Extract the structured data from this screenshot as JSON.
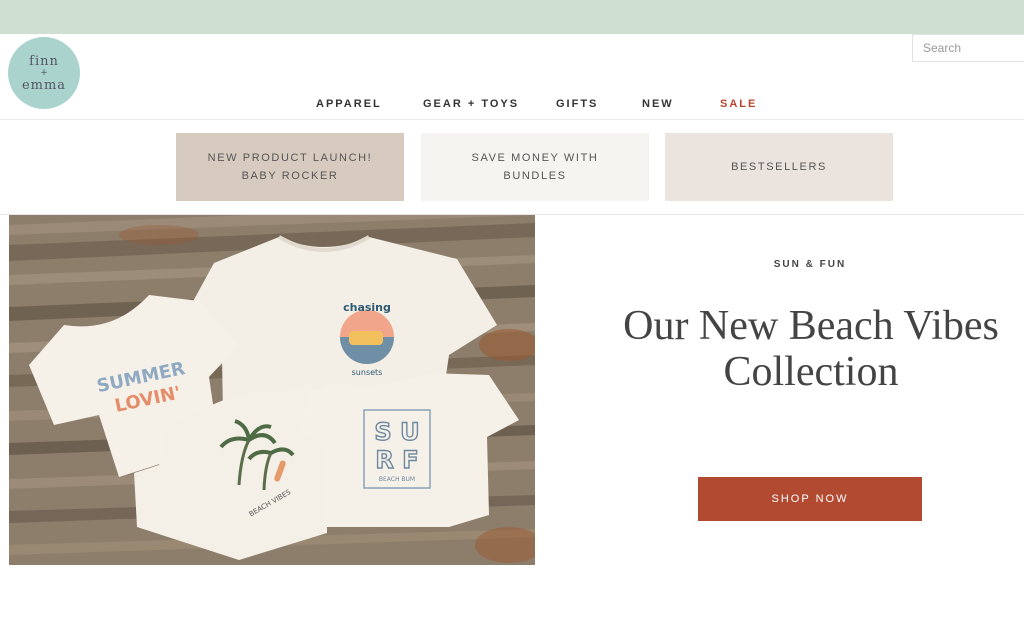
{
  "colors": {
    "topbar": "#cfe0d3",
    "logo_bg": "#a9d3cc",
    "sale": "#b4472d",
    "cta": "#b14a31",
    "promo1_bg": "#d7cbc0",
    "promo2_bg": "#f6f4f1",
    "promo3_bg": "#ebe3de",
    "wood": "#8d7d6b"
  },
  "logo": {
    "line1": "finn",
    "line2": "+",
    "line3": "emma"
  },
  "search": {
    "placeholder": "Search"
  },
  "nav": {
    "items": [
      "APPAREL",
      "GEAR + TOYS",
      "GIFTS",
      "NEW",
      "SALE"
    ]
  },
  "promos": [
    {
      "line1": "NEW PRODUCT LAUNCH!",
      "line2": "BABY ROCKER"
    },
    {
      "line1": "SAVE MONEY WITH",
      "line2": "BUNDLES"
    },
    {
      "line1": "BESTSELLERS"
    }
  ],
  "hero": {
    "eyebrow": "SUN & FUN",
    "headline_line1": "Our New Beach Vibes",
    "headline_line2": "Collection",
    "cta": "SHOP NOW"
  },
  "shirts": {
    "shirt1_line1": "SUMMER",
    "shirt1_line2": "LOVIN'",
    "shirt2_top": "chasing",
    "shirt2_bottom": "sunsets",
    "shirt3_text": "BEACH VIBES",
    "shirt4_line1": "S U",
    "shirt4_line2": "R F",
    "shirt4_small": "BEACH BUM"
  }
}
